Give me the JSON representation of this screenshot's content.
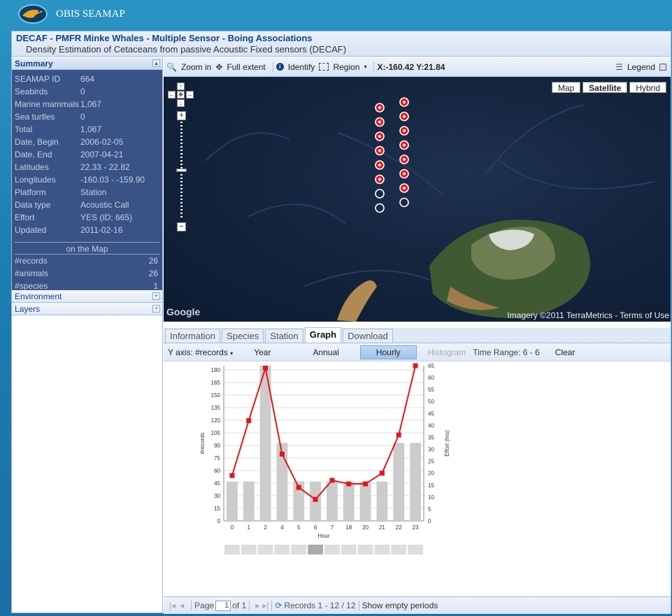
{
  "brand": "OBIS SEAMAP",
  "title": {
    "main": "DECAF - PMFR Minke Whales - Multiple Sensor - Boing Associations",
    "sub": "Density Estimation of Cetaceans from passive Acoustic Fixed sensors (DECAF)"
  },
  "summary": {
    "header": "Summary",
    "rows": [
      {
        "k": "SEAMAP ID",
        "v": "664"
      },
      {
        "k": "Seabirds",
        "v": "0"
      },
      {
        "k": "Marine mammals",
        "v": "1,067"
      },
      {
        "k": "Sea turtles",
        "v": "0"
      },
      {
        "k": "Total",
        "v": "1,067"
      },
      {
        "k": "Date, Begin",
        "v": "2006-02-05"
      },
      {
        "k": "Date, End",
        "v": "2007-04-21"
      },
      {
        "k": "Latitudes",
        "v": "22.33 - 22.82"
      },
      {
        "k": "Longitudes",
        "v": "-160.03 - -159.90"
      },
      {
        "k": "Platform",
        "v": "Station"
      },
      {
        "k": "Data type",
        "v": "Acoustic Call"
      },
      {
        "k": "Effort",
        "v": "YES (ID: 665)"
      },
      {
        "k": "Updated",
        "v": "2011-02-16"
      }
    ],
    "on_map_label": "on the Map",
    "map_rows": [
      {
        "k": "#records",
        "v": "26"
      },
      {
        "k": "#animals",
        "v": "26"
      },
      {
        "k": "#species",
        "v": "1"
      }
    ]
  },
  "environment": "Environment",
  "layers": "Layers",
  "toolbar": {
    "zoom_in": "Zoom in",
    "full_extent": "Full extent",
    "identify": "Identify",
    "region": "Region",
    "coords": "X:-160.42 Y:21.84",
    "legend": "Legend"
  },
  "map": {
    "types": [
      "Map",
      "Satellite",
      "Hybrid"
    ],
    "active": "Satellite",
    "google": "Google",
    "credit": "Imagery ©2011 TerraMetrics - Terms of Use"
  },
  "tabs": [
    "Information",
    "Species",
    "Station",
    "Graph",
    "Download"
  ],
  "active_tab": "Graph",
  "graph_bar": {
    "yaxis": "Y axis: #records",
    "year": "Year",
    "annual": "Annual",
    "hourly": "Hourly",
    "histogram": "Histogram",
    "time_range": "Time Range: 6 - 6",
    "clear": "Clear"
  },
  "pager": {
    "page": "Page",
    "page_value": "1",
    "of": "of 1",
    "records": "Records 1 - 12 / 12",
    "empty": "Show empty periods"
  },
  "chart_data": {
    "type": "bar",
    "categories": [
      "0",
      "1",
      "2",
      "4",
      "5",
      "6",
      "7",
      "18",
      "20",
      "21",
      "22",
      "23"
    ],
    "series": [
      {
        "name": "#records",
        "type": "bar",
        "values": [
          47,
          47,
          185,
          93,
          47,
          47,
          47,
          47,
          47,
          47,
          93,
          93
        ],
        "color": "#cccccc"
      },
      {
        "name": "Effort (hrs)",
        "type": "line",
        "values": [
          19,
          42,
          64,
          28,
          14,
          9,
          17,
          15.5,
          15.5,
          20,
          36,
          65
        ],
        "color": "#e0161b"
      }
    ],
    "xlabel": "Hour",
    "ylabel": "#records",
    "y2label": "Effort (hrs)",
    "ylim": [
      0,
      185
    ],
    "y2lim": [
      0,
      65
    ],
    "yticks": [
      0,
      15,
      30,
      45,
      60,
      75,
      90,
      105,
      120,
      135,
      150,
      165,
      180
    ],
    "y2ticks": [
      0,
      5,
      10,
      15,
      20,
      25,
      30,
      35,
      40,
      45,
      50,
      55,
      60,
      65
    ],
    "selected_index": 5
  }
}
